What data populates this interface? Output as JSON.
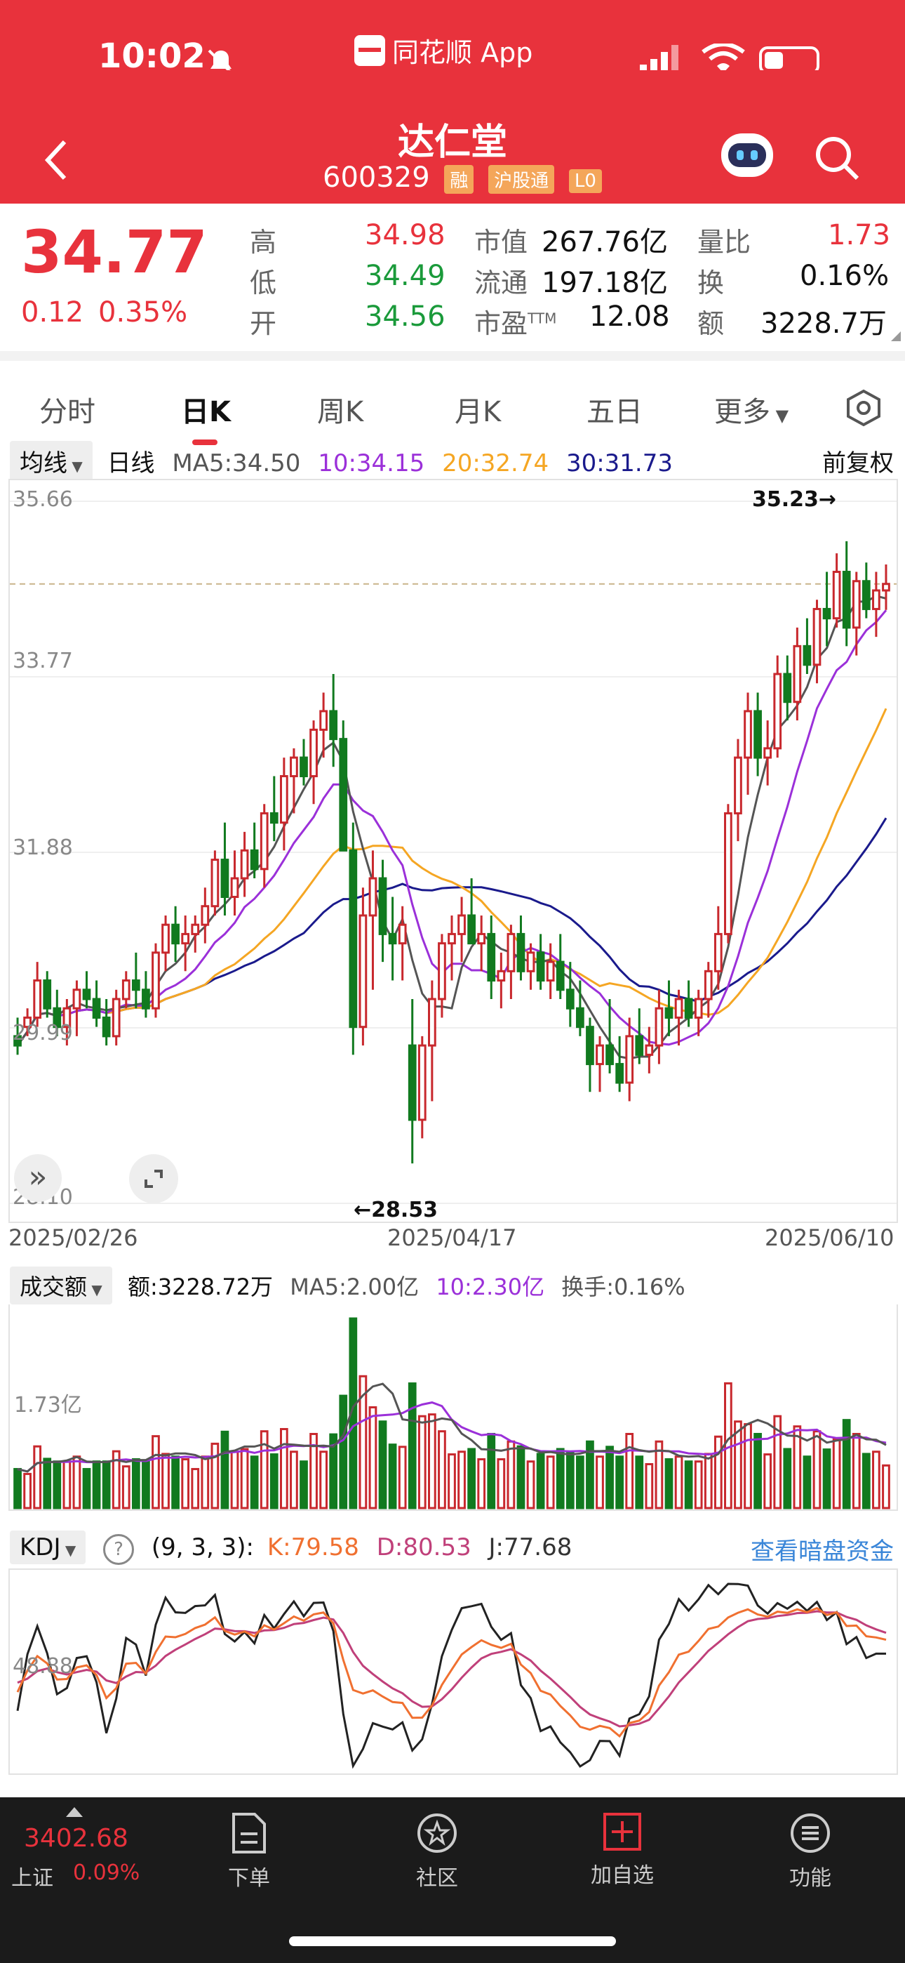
{
  "status_bar": {
    "time": "10:02",
    "app_name": "同花顺 App"
  },
  "header": {
    "title": "达仁堂",
    "code": "600329",
    "tags": [
      "融",
      "沪股通",
      "L0"
    ]
  },
  "quote": {
    "price": "34.77",
    "change": "0.12",
    "change_pct": "0.35%",
    "high_label": "高",
    "high": "34.98",
    "low_label": "低",
    "low": "34.49",
    "open_label": "开",
    "open": "34.56",
    "mcap_label": "市值",
    "mcap": "267.76亿",
    "float_label": "流通",
    "float": "197.18亿",
    "pe_label": "市盈",
    "pe_sup": "TTM",
    "pe": "12.08",
    "vr_label": "量比",
    "vr": "1.73",
    "turnover_label": "换",
    "turnover": "0.16%",
    "amount_label": "额",
    "amount": "3228.7万"
  },
  "tabs": [
    "分时",
    "日K",
    "周K",
    "月K",
    "五日",
    "更多"
  ],
  "active_tab": 1,
  "ma_bar": {
    "selector": "均线",
    "period": "日线",
    "ma5": "MA5:34.50",
    "ma10": "10:34.15",
    "ma20": "20:32.74",
    "ma30": "30:31.73",
    "adjust": "前复权"
  },
  "kline": {
    "y_labels": [
      "35.66",
      "33.77",
      "31.88",
      "29.99",
      "28.10"
    ],
    "x_labels": [
      "2025/02/26",
      "2025/04/17",
      "2025/06/10"
    ],
    "max_label": "35.23→",
    "min_label": "←28.53"
  },
  "volume_bar": {
    "selector": "成交额",
    "amount": "额:3228.72万",
    "ma5": "MA5:2.00亿",
    "ma10": "10:2.30亿",
    "turnover": "换手:0.16%",
    "y_label": "1.73亿"
  },
  "kdj_bar": {
    "selector": "KDJ",
    "help": "?",
    "params": "(9, 3, 3):",
    "k": "K:79.58",
    "d": "D:80.53",
    "j": "J:77.68",
    "link": "查看暗盘资金",
    "y_label": "48.88"
  },
  "bottom_bar": {
    "index_value": "3402.68",
    "index_name": "上证",
    "index_pct": "0.09%",
    "items": [
      "下单",
      "社区",
      "加自选",
      "功能"
    ]
  },
  "colors": {
    "up": "#c8282d",
    "down": "#117a1f",
    "ma5": "#555555",
    "ma10": "#9b30d9",
    "ma20": "#f5a623",
    "ma30": "#1a1a8c",
    "k": "#f07030",
    "d": "#c0407a",
    "j": "#222222"
  },
  "chart_data": {
    "type": "candlestick",
    "ylim": [
      28.1,
      35.66
    ],
    "x_ticks": [
      "2025/02/26",
      "2025/04/17",
      "2025/06/10"
    ],
    "candles": [
      [
        29.9,
        30.1,
        29.7,
        29.8
      ],
      [
        30.0,
        30.2,
        29.9,
        30.1
      ],
      [
        30.1,
        30.7,
        30.0,
        30.5
      ],
      [
        30.5,
        30.6,
        30.1,
        30.2
      ],
      [
        30.2,
        30.4,
        29.9,
        30.0
      ],
      [
        30.0,
        30.3,
        29.8,
        30.2
      ],
      [
        30.2,
        30.5,
        29.9,
        30.4
      ],
      [
        30.4,
        30.6,
        30.2,
        30.3
      ],
      [
        30.3,
        30.5,
        30.0,
        30.1
      ],
      [
        30.1,
        30.3,
        29.8,
        29.9
      ],
      [
        29.9,
        30.4,
        29.8,
        30.3
      ],
      [
        30.3,
        30.6,
        30.2,
        30.5
      ],
      [
        30.5,
        30.8,
        30.2,
        30.4
      ],
      [
        30.4,
        30.6,
        30.1,
        30.2
      ],
      [
        30.2,
        30.9,
        30.1,
        30.8
      ],
      [
        30.8,
        31.2,
        30.6,
        31.1
      ],
      [
        31.1,
        31.3,
        30.7,
        30.9
      ],
      [
        30.9,
        31.2,
        30.6,
        31.0
      ],
      [
        31.0,
        31.2,
        30.8,
        31.1
      ],
      [
        31.1,
        31.5,
        30.9,
        31.3
      ],
      [
        31.3,
        31.9,
        31.2,
        31.8
      ],
      [
        31.8,
        32.2,
        31.2,
        31.4
      ],
      [
        31.4,
        31.9,
        31.2,
        31.6
      ],
      [
        31.6,
        32.1,
        31.4,
        31.9
      ],
      [
        31.9,
        32.2,
        31.6,
        31.7
      ],
      [
        31.7,
        32.4,
        31.5,
        32.3
      ],
      [
        32.3,
        32.7,
        32.0,
        32.2
      ],
      [
        32.2,
        32.9,
        31.9,
        32.7
      ],
      [
        32.7,
        33.0,
        32.3,
        32.9
      ],
      [
        32.9,
        33.1,
        32.6,
        32.7
      ],
      [
        32.7,
        33.3,
        32.4,
        33.2
      ],
      [
        33.2,
        33.6,
        32.9,
        33.4
      ],
      [
        33.4,
        33.8,
        32.8,
        33.1
      ],
      [
        33.1,
        33.3,
        32.0,
        31.9
      ],
      [
        31.9,
        32.2,
        29.7,
        30.0
      ],
      [
        30.0,
        31.5,
        29.8,
        31.2
      ],
      [
        31.2,
        31.9,
        30.4,
        31.6
      ],
      [
        31.6,
        31.8,
        30.7,
        31.0
      ],
      [
        31.0,
        31.4,
        30.5,
        30.9
      ],
      [
        30.9,
        31.3,
        30.5,
        31.1
      ],
      [
        29.8,
        30.3,
        28.53,
        29.0
      ],
      [
        29.0,
        29.9,
        28.8,
        29.8
      ],
      [
        29.8,
        30.5,
        29.2,
        30.3
      ],
      [
        30.3,
        31.0,
        30.1,
        30.9
      ],
      [
        30.9,
        31.2,
        30.5,
        31.0
      ],
      [
        31.0,
        31.4,
        30.7,
        31.2
      ],
      [
        31.2,
        31.6,
        30.9,
        30.9
      ],
      [
        30.9,
        31.2,
        30.6,
        31.0
      ],
      [
        31.0,
        31.2,
        30.3,
        30.5
      ],
      [
        30.5,
        30.8,
        30.2,
        30.6
      ],
      [
        30.6,
        31.1,
        30.3,
        31.0
      ],
      [
        31.0,
        31.2,
        30.5,
        30.6
      ],
      [
        30.6,
        30.9,
        30.4,
        30.8
      ],
      [
        30.8,
        31.0,
        30.4,
        30.5
      ],
      [
        30.5,
        30.9,
        30.3,
        30.7
      ],
      [
        30.7,
        31.0,
        30.3,
        30.4
      ],
      [
        30.4,
        30.7,
        30.0,
        30.2
      ],
      [
        30.2,
        30.5,
        29.9,
        30.0
      ],
      [
        30.0,
        30.1,
        29.3,
        29.6
      ],
      [
        29.6,
        29.9,
        29.3,
        29.8
      ],
      [
        29.8,
        30.3,
        29.5,
        29.6
      ],
      [
        29.6,
        29.9,
        29.3,
        29.4
      ],
      [
        29.4,
        30.1,
        29.2,
        29.9
      ],
      [
        29.9,
        30.2,
        29.6,
        29.7
      ],
      [
        29.7,
        30.0,
        29.5,
        29.8
      ],
      [
        29.8,
        30.4,
        29.6,
        30.2
      ],
      [
        30.2,
        30.5,
        29.9,
        30.1
      ],
      [
        30.1,
        30.4,
        29.8,
        30.3
      ],
      [
        30.3,
        30.5,
        30.0,
        30.1
      ],
      [
        30.1,
        30.4,
        29.9,
        30.3
      ],
      [
        30.3,
        30.7,
        30.1,
        30.6
      ],
      [
        30.6,
        31.3,
        30.4,
        31.0
      ],
      [
        31.0,
        32.4,
        30.9,
        32.3
      ],
      [
        32.3,
        33.1,
        32.0,
        32.9
      ],
      [
        32.9,
        33.6,
        32.5,
        33.4
      ],
      [
        33.4,
        33.6,
        32.7,
        32.9
      ],
      [
        32.9,
        33.3,
        32.6,
        33.0
      ],
      [
        33.0,
        34.0,
        32.9,
        33.8
      ],
      [
        33.8,
        34.0,
        33.3,
        33.5
      ],
      [
        33.5,
        34.3,
        33.3,
        34.1
      ],
      [
        34.1,
        34.4,
        33.8,
        33.9
      ],
      [
        33.9,
        34.6,
        33.7,
        34.5
      ],
      [
        34.5,
        34.9,
        34.1,
        34.4
      ],
      [
        34.4,
        35.1,
        34.3,
        34.9
      ],
      [
        34.9,
        35.23,
        34.1,
        34.3
      ],
      [
        34.3,
        34.9,
        34.0,
        34.8
      ],
      [
        34.8,
        35.0,
        34.4,
        34.5
      ],
      [
        34.5,
        34.9,
        34.2,
        34.7
      ],
      [
        34.7,
        34.98,
        34.49,
        34.77
      ]
    ]
  }
}
